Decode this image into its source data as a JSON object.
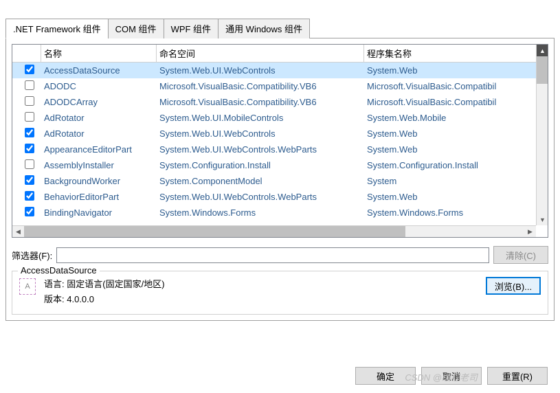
{
  "tabs": [
    {
      "label": ".NET Framework 组件",
      "active": true
    },
    {
      "label": "COM 组件",
      "active": false
    },
    {
      "label": "WPF 组件",
      "active": false
    },
    {
      "label": "通用 Windows 组件",
      "active": false
    }
  ],
  "columns": {
    "name": "名称",
    "namespace": "命名空间",
    "assembly": "程序集名称"
  },
  "rows": [
    {
      "checked": true,
      "selected": true,
      "name": "AccessDataSource",
      "ns": "System.Web.UI.WebControls",
      "asm": "System.Web"
    },
    {
      "checked": false,
      "selected": false,
      "name": "ADODC",
      "ns": "Microsoft.VisualBasic.Compatibility.VB6",
      "asm": "Microsoft.VisualBasic.Compatibil"
    },
    {
      "checked": false,
      "selected": false,
      "name": "ADODCArray",
      "ns": "Microsoft.VisualBasic.Compatibility.VB6",
      "asm": "Microsoft.VisualBasic.Compatibil"
    },
    {
      "checked": false,
      "selected": false,
      "name": "AdRotator",
      "ns": "System.Web.UI.MobileControls",
      "asm": "System.Web.Mobile"
    },
    {
      "checked": true,
      "selected": false,
      "name": "AdRotator",
      "ns": "System.Web.UI.WebControls",
      "asm": "System.Web"
    },
    {
      "checked": true,
      "selected": false,
      "name": "AppearanceEditorPart",
      "ns": "System.Web.UI.WebControls.WebParts",
      "asm": "System.Web"
    },
    {
      "checked": false,
      "selected": false,
      "name": "AssemblyInstaller",
      "ns": "System.Configuration.Install",
      "asm": "System.Configuration.Install"
    },
    {
      "checked": true,
      "selected": false,
      "name": "BackgroundWorker",
      "ns": "System.ComponentModel",
      "asm": "System"
    },
    {
      "checked": true,
      "selected": false,
      "name": "BehaviorEditorPart",
      "ns": "System.Web.UI.WebControls.WebParts",
      "asm": "System.Web"
    },
    {
      "checked": true,
      "selected": false,
      "name": "BindingNavigator",
      "ns": "System.Windows.Forms",
      "asm": "System.Windows.Forms"
    }
  ],
  "filter": {
    "label": "筛选器(F):",
    "value": "",
    "clear": "清除(C)"
  },
  "details": {
    "title": "AccessDataSource",
    "lang_label": "语言:",
    "lang_value": "固定语言(固定国家/地区)",
    "ver_label": "版本:",
    "ver_value": "4.0.0.0",
    "browse": "浏览(B)..."
  },
  "buttons": {
    "ok": "确定",
    "cancel": "取消",
    "reset": "重置(R)"
  },
  "watermark": "CSDN @编程老司"
}
